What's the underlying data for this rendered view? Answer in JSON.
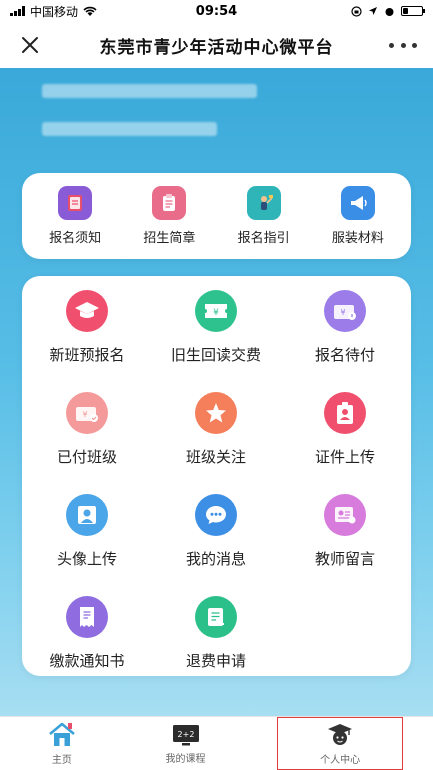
{
  "status_bar": {
    "carrier": "中国移动",
    "time": "09:54"
  },
  "nav": {
    "title": "东莞市青少年活动中心微平台",
    "close_icon": "close-icon",
    "more_icon": "more-icon"
  },
  "quick_links": [
    {
      "label": "报名须知",
      "icon": "book-icon",
      "color": "#8a5bd6"
    },
    {
      "label": "招生简章",
      "icon": "clipboard-icon",
      "color": "#e96c8a"
    },
    {
      "label": "报名指引",
      "icon": "guide-icon",
      "color": "#2fb5b8"
    },
    {
      "label": "服装材料",
      "icon": "megaphone-icon",
      "color": "#3a8ee6"
    }
  ],
  "grid": [
    {
      "label": "新班预报名",
      "icon": "graduation-cap-icon",
      "color": "#f0506e"
    },
    {
      "label": "旧生回读交费",
      "icon": "ticket-icon",
      "color": "#2ec28e"
    },
    {
      "label": "报名待付",
      "icon": "wallet-icon",
      "color": "#9b7ce8"
    },
    {
      "label": "已付班级",
      "icon": "paid-wallet-icon",
      "color": "#f59a9a"
    },
    {
      "label": "班级关注",
      "icon": "star-icon",
      "color": "#f57f5b"
    },
    {
      "label": "证件上传",
      "icon": "id-badge-icon",
      "color": "#f0506e"
    },
    {
      "label": "头像上传",
      "icon": "portrait-icon",
      "color": "#4aa6e8"
    },
    {
      "label": "我的消息",
      "icon": "chat-icon",
      "color": "#3d8fe6"
    },
    {
      "label": "教师留言",
      "icon": "message-card-icon",
      "color": "#d77bdc"
    },
    {
      "label": "缴款通知书",
      "icon": "receipt-icon",
      "color": "#8f6de0"
    },
    {
      "label": "退费申请",
      "icon": "refund-form-icon",
      "color": "#2bc08a"
    }
  ],
  "tabs": [
    {
      "label": "主页",
      "icon": "home-icon"
    },
    {
      "label": "我的课程",
      "icon": "blackboard-icon"
    },
    {
      "label": "个人中心",
      "icon": "student-avatar-icon"
    }
  ]
}
